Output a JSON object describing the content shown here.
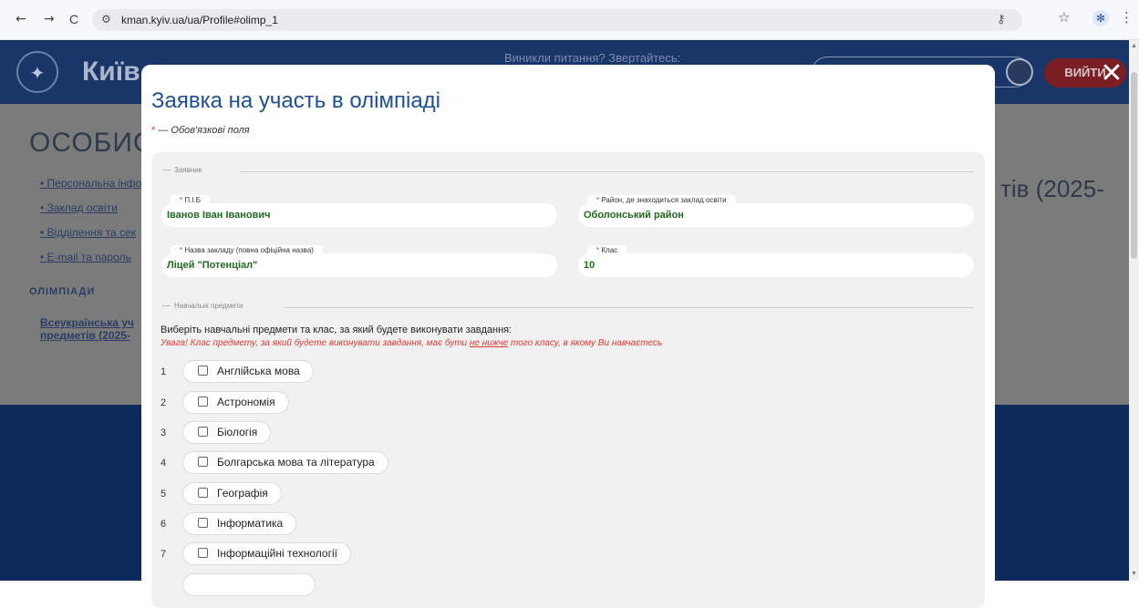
{
  "browser": {
    "back_icon": "←",
    "forward_icon": "→",
    "reload_icon": "C",
    "site_info_icon": "⚙",
    "url": "kman.kyiv.ua/ua/Profile#olimp_1",
    "key_icon": "⚷",
    "star_icon": "☆",
    "extension_icon": "✻",
    "menu_icon": "⋮"
  },
  "site": {
    "title": "Київ",
    "question": "Виникли питання? Звертайтесь:",
    "logout_label": "ВИЙТИ",
    "profile_heading": "ОСОБИСТ",
    "nav": [
      "Персональна інфо",
      "Заклад освіти",
      "Відділення та сек",
      "E-mail та пароль"
    ],
    "section_label": "ОЛІМПІАДИ",
    "olympiad_link": "Всеукраїнська уч предметів (2025-",
    "side_text": "тів (2025-"
  },
  "modal": {
    "close_icon": "✕",
    "title": "Заявка на участь в олімпіаді",
    "required_star": "*",
    "required_note": " — Обов'язкові поля",
    "applicant_legend": "Заявник",
    "fields": {
      "full_name": {
        "label": "П.І.Б",
        "value": "Іванов Іван Іванович"
      },
      "district": {
        "label": "Район, де знаходиться заклад освіти",
        "value": "Оболонський район"
      },
      "school": {
        "label": "Назва закладу (повна офіційна назва)",
        "value": "Ліцей \"Потенціал\""
      },
      "grade": {
        "label": "Клас",
        "value": "10"
      }
    },
    "subjects_legend": "Навчальні предмети",
    "instruction": "Виберіть навчальні предмети та клас, за який будете виконувати завдання:",
    "warning_prefix": "Увага! Клас предмету, за який будете виконувати завдання, має бути ",
    "warning_underlined": "не нижче",
    "warning_suffix": " того класу, в якому Ви навчаєтесь",
    "subjects": [
      {
        "num": "1",
        "label": "Англійська мова"
      },
      {
        "num": "2",
        "label": "Астрономія"
      },
      {
        "num": "3",
        "label": "Біологія"
      },
      {
        "num": "4",
        "label": "Болгарська мова та література"
      },
      {
        "num": "5",
        "label": "Географія"
      },
      {
        "num": "6",
        "label": "Інформатика"
      },
      {
        "num": "7",
        "label": "Інформаційні технології"
      }
    ]
  }
}
